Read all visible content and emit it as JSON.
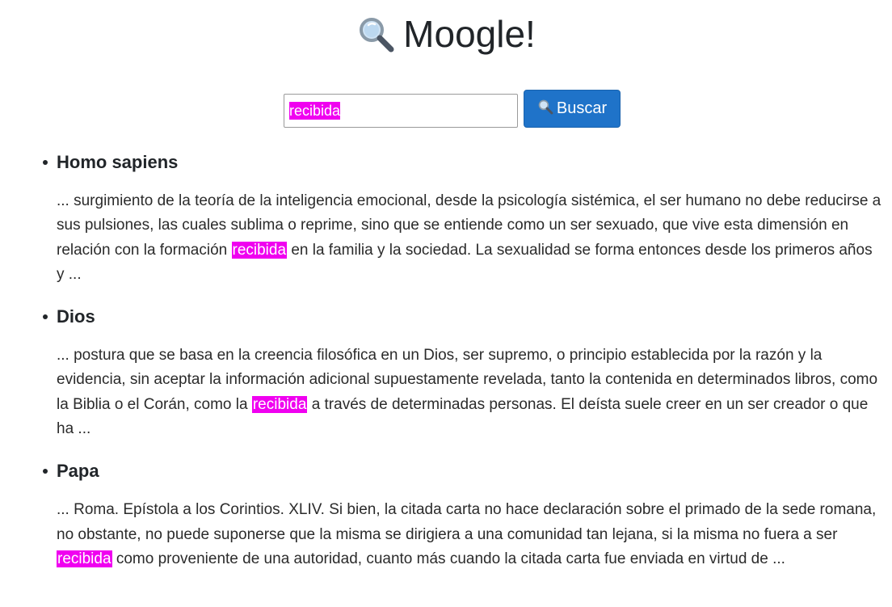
{
  "header": {
    "title": "Moogle!",
    "icon": "magnifying-glass-icon"
  },
  "search": {
    "query": "recibida",
    "button_label": "Buscar",
    "highlight_color": "#f000f0",
    "button_color": "#1f73c9"
  },
  "results": [
    {
      "title": "Homo sapiens",
      "before": "... surgimiento de la teoría de la inteligencia emocional, desde la psicología sistémica, el ser humano no debe reducirse a sus pulsiones, las cuales sublima o reprime, sino que se entiende como un ser sexuado, que vive esta dimensión en relación con la formación",
      "match": "recibida",
      "after": "en la familia y la sociedad. La sexualidad se forma entonces desde los primeros años y ..."
    },
    {
      "title": "Dios",
      "before": "... postura que se basa en la creencia filosófica en un Dios, ser supremo, o principio establecida por la razón y la evidencia, sin aceptar la información adicional supuestamente revelada, tanto la contenida en determinados libros, como la Biblia o el Corán, como la",
      "match": "recibida",
      "after": "a través de determinadas personas. El deísta suele creer en un ser creador o que ha ..."
    },
    {
      "title": "Papa",
      "before": "... Roma. Epístola a los Corintios. XLIV.  Si bien, la citada carta no hace declaración sobre el primado de la sede romana, no obstante, no puede suponerse que la misma se dirigiera a una comunidad tan lejana, si la misma no fuera a ser",
      "match": "recibida",
      "after": "como proveniente de una autoridad, cuanto más cuando la citada carta fue enviada en virtud de ..."
    }
  ]
}
